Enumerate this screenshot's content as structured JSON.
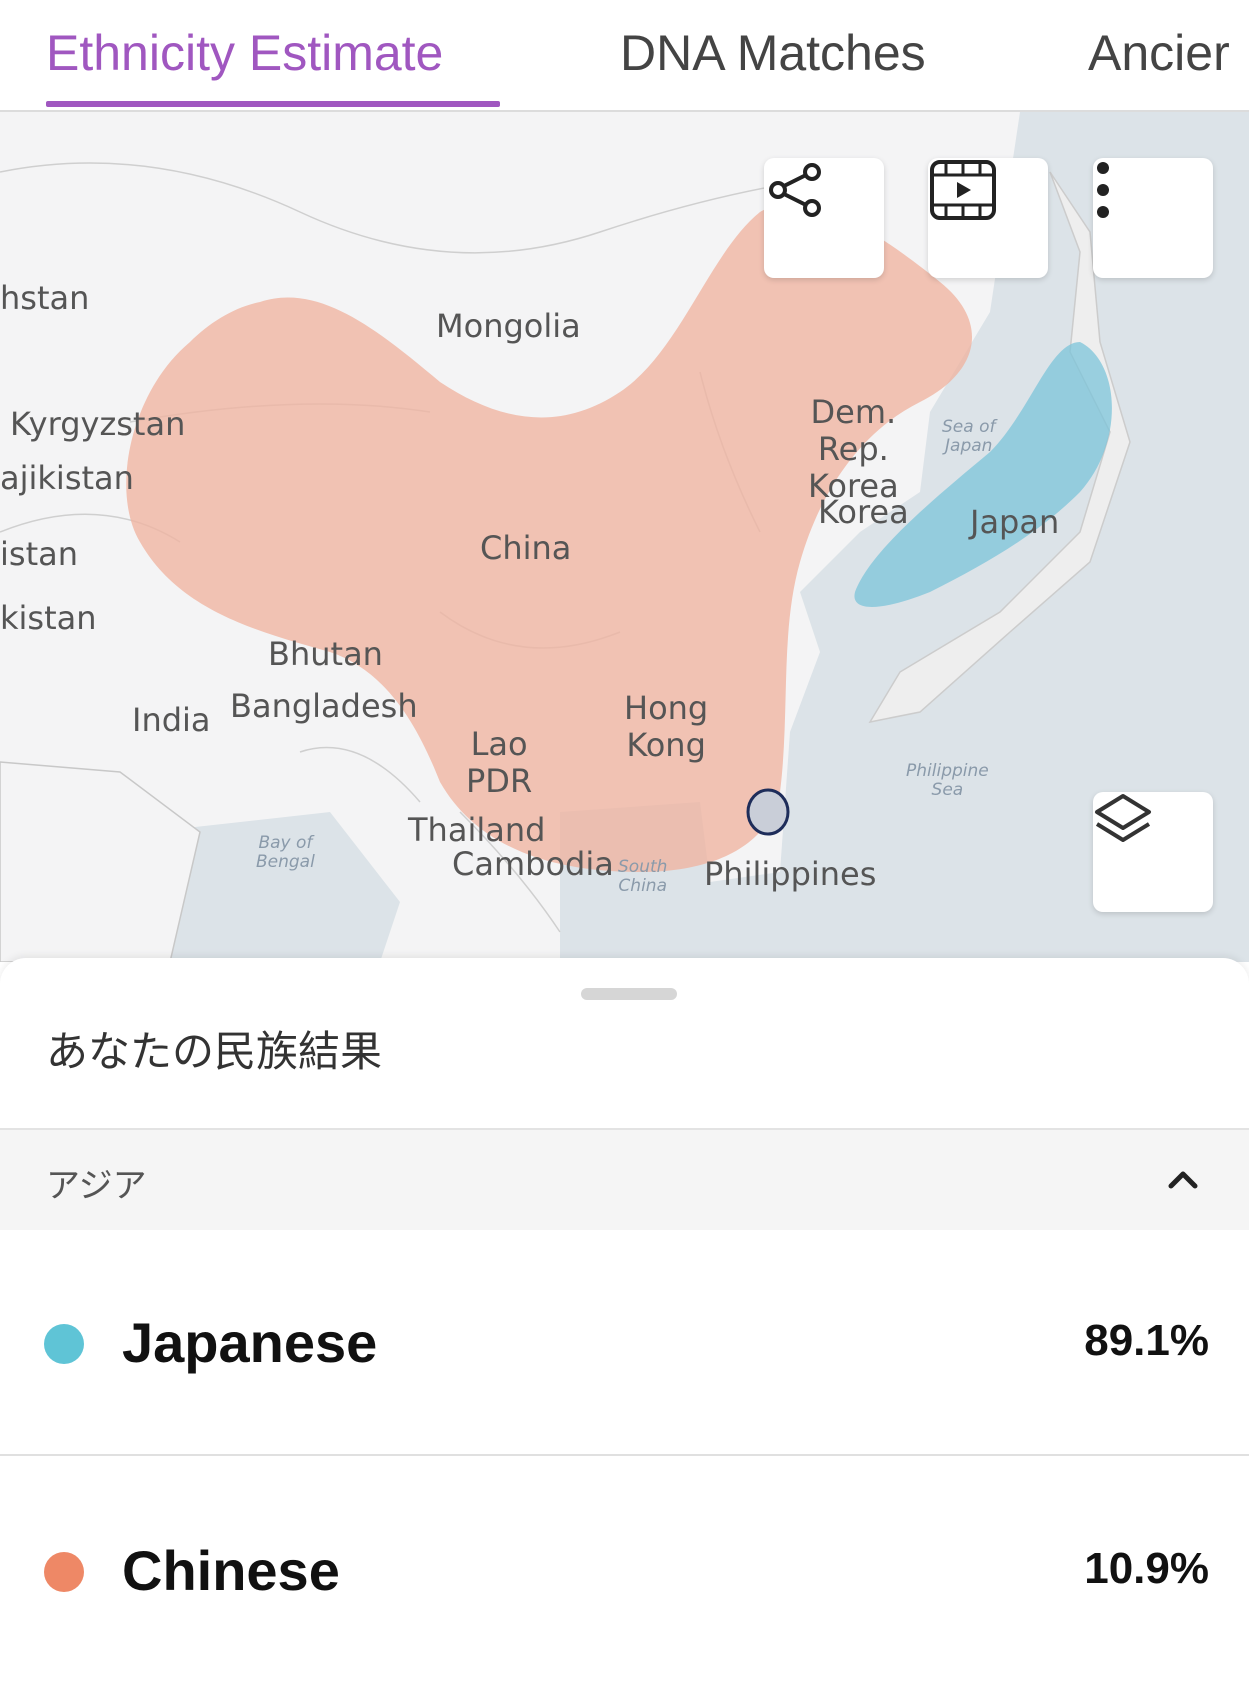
{
  "tabs": [
    {
      "label": "Ethnicity Estimate",
      "active": true
    },
    {
      "label": "DNA Matches",
      "active": false
    },
    {
      "label": "Ancier",
      "active": false
    }
  ],
  "map": {
    "labels": {
      "kazakhstan": "hstan",
      "mongolia": "Mongolia",
      "kyrgyzstan": "Kyrgyzstan",
      "tajikistan": "ajikistan",
      "afghanistan": "istan",
      "pakistan": "kistan",
      "china": "China",
      "bhutan": "Bhutan",
      "india": "India",
      "bangladesh": "Bangladesh",
      "lao": "Lao\nPDR",
      "hong_kong": "Hong\nKong",
      "thailand": "Thailand",
      "cambodia": "Cambodia",
      "philippines": "Philippines",
      "dprk": "Dem.\nRep.\nKorea",
      "korea": "Korea",
      "japan": "Japan"
    },
    "sea_labels": {
      "sea_of_japan": "Sea of\nJapan",
      "philippine_sea": "Philippine\nSea",
      "bay_of_bengal": "Bay of\nBengal",
      "south_china": "South\nChina"
    },
    "region_colors": {
      "chinese": "#efb3a0",
      "japanese": "#7cc4da",
      "outline": "#1e2d5a"
    },
    "buttons": {
      "share": "share-icon",
      "video": "video-icon",
      "more": "more-vertical-icon",
      "layers": "layers-icon"
    }
  },
  "sheet": {
    "title": "あなたの民族結果",
    "section": "アジア",
    "results": [
      {
        "name": "Japanese",
        "percent": "89.1%",
        "color": "#5fc4d6"
      },
      {
        "name": "Chinese",
        "percent": "10.9%",
        "color": "#ee8866"
      }
    ]
  }
}
